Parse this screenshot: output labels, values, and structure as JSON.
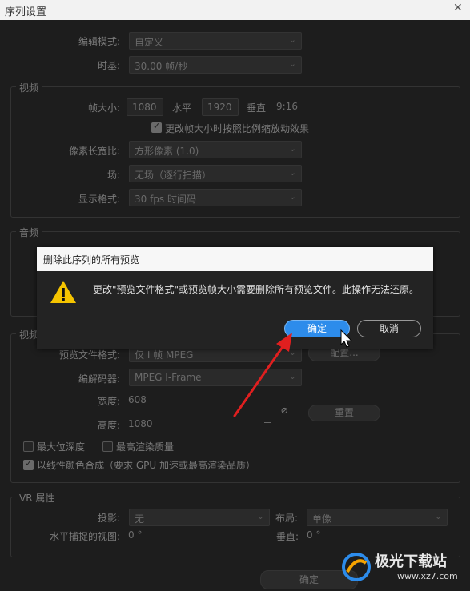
{
  "window": {
    "title": "序列设置",
    "close_glyph": "✕"
  },
  "general": {
    "edit_mode_label": "编辑模式:",
    "edit_mode_value": "自定义",
    "timebase_label": "时基:",
    "timebase_value": "30.00  帧/秒"
  },
  "video": {
    "group_title": "视频",
    "frame_size_label": "帧大小:",
    "width": "1080",
    "horizontal_label": "水平",
    "height": "1920",
    "vertical_label": "垂直",
    "aspect": "9:16",
    "scale_checkbox": "更改帧大小时按照比例缩放动效果",
    "pixel_aspect_label": "像素长宽比:",
    "pixel_aspect_value": "方形像素 (1.0)",
    "fields_label": "场:",
    "fields_value": "无场（逐行扫描）",
    "display_format_label": "显示格式:",
    "display_format_value": "30 fps 时间码"
  },
  "audio": {
    "group_title": "音频"
  },
  "preview": {
    "group_title": "视频",
    "file_format_label": "预览文件格式:",
    "file_format_value": "仅 I 帧 MPEG",
    "configure_button": "配置...",
    "codec_label": "编解码器:",
    "codec_value": "MPEG I-Frame",
    "width_label": "宽度:",
    "width_value": "608",
    "height_label": "高度:",
    "height_value": "1080",
    "reset_button": "重置"
  },
  "options": {
    "max_bit_depth": "最大位深度",
    "max_render_quality": "最高渲染质量",
    "linear_color": "以线性颜色合成（要求 GPU 加速或最高渲染品质）"
  },
  "vr": {
    "group_title": "VR 属性",
    "projection_label": "投影:",
    "projection_value": "无",
    "layout_label": "布局:",
    "layout_value": "单像",
    "h_view_label": "水平捕捉的视图:",
    "h_view_value": "0 °",
    "v_label": "垂直:",
    "v_value": "0 °"
  },
  "footer": {
    "ok_label": "确定"
  },
  "dialog": {
    "title": "删除此序列的所有预览",
    "message": "更改\"预览文件格式\"或预览帧大小需要删除所有预览文件。此操作无法还原。",
    "ok_label": "确定",
    "cancel_label": "取消",
    "icon": "warning-icon"
  },
  "watermark": {
    "text": "极光下载站",
    "url": "www.xz7.com"
  },
  "colors": {
    "accent": "#2d8ceb",
    "warning": "#f5c400",
    "arrow": "#e01f1f"
  }
}
